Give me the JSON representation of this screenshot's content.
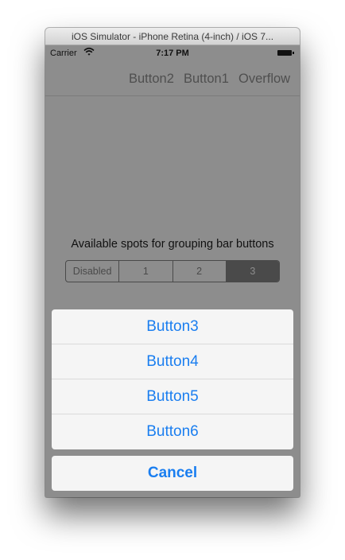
{
  "window": {
    "title": "iOS Simulator - iPhone Retina (4-inch) / iOS 7..."
  },
  "status_bar": {
    "carrier": "Carrier",
    "time": "7:17 PM",
    "wifi_icon": "wifi-icon",
    "battery_icon": "battery-icon"
  },
  "nav_bar": {
    "buttons": [
      "Button2",
      "Button1",
      "Overflow"
    ]
  },
  "content": {
    "caption": "Available spots for grouping bar buttons",
    "segments": [
      "Disabled",
      "1",
      "2",
      "3"
    ],
    "selected_segment": "3"
  },
  "action_sheet": {
    "buttons": [
      "Button3",
      "Button4",
      "Button5",
      "Button6"
    ],
    "cancel": "Cancel"
  },
  "colors": {
    "tint": "#1a7ef0",
    "dim_overlay": "#8d8d8d",
    "sheet_background": "#f5f5f5"
  }
}
